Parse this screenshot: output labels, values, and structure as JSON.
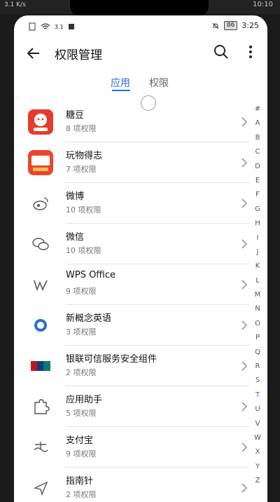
{
  "device": {
    "bezel_left": "3.1 K/s",
    "bezel_right": "10:10",
    "status_left_icons": [
      "sim-icon",
      "wifi-icon",
      "data-icon"
    ],
    "battery": "86",
    "time": "3:25"
  },
  "header": {
    "title": "权限管理",
    "back_icon": "back-arrow-icon",
    "search_icon": "search-icon",
    "more_icon": "more-vertical-icon"
  },
  "tabs": [
    {
      "label": "应用",
      "active": true
    },
    {
      "label": "权限",
      "active": false
    }
  ],
  "apps": [
    {
      "name": "糖豆",
      "perm": "8 项权限",
      "icon": "tangdou-icon",
      "color": "#e53b2c"
    },
    {
      "name": "玩物得志",
      "perm": "7 项权限",
      "icon": "wanwudezhi-icon",
      "color": "#e8472f"
    },
    {
      "name": "微博",
      "perm": "10 项权限",
      "icon": "weibo-icon",
      "color": "#666666"
    },
    {
      "name": "微信",
      "perm": "10 项权限",
      "icon": "wechat-icon",
      "color": "#666666"
    },
    {
      "name": "WPS Office",
      "perm": "9 项权限",
      "icon": "wps-icon",
      "color": "#666666"
    },
    {
      "name": "新概念英语",
      "perm": "3 项权限",
      "icon": "xingainian-icon",
      "color": "#2b6fd8"
    },
    {
      "name": "银联可信服务安全组件",
      "perm": "2 项权限",
      "icon": "unionpay-icon",
      "color": "#c4161c"
    },
    {
      "name": "应用助手",
      "perm": "5 项权限",
      "icon": "puzzle-icon",
      "color": "#666666"
    },
    {
      "name": "支付宝",
      "perm": "9 项权限",
      "icon": "alipay-icon",
      "color": "#666666"
    },
    {
      "name": "指南针",
      "perm": "2 项权限",
      "icon": "compass-icon",
      "color": "#666666"
    }
  ],
  "alphabet": [
    "#",
    "A",
    "B",
    "C",
    "D",
    "E",
    "F",
    "G",
    "H",
    "I",
    "J",
    "K",
    "L",
    "M",
    "N",
    "O",
    "P",
    "Q",
    "R",
    "S",
    "T",
    "U",
    "V",
    "W",
    "X",
    "Y",
    "Z"
  ],
  "alphabet_active": "T",
  "colors": {
    "accent": "#2b6fd8"
  }
}
